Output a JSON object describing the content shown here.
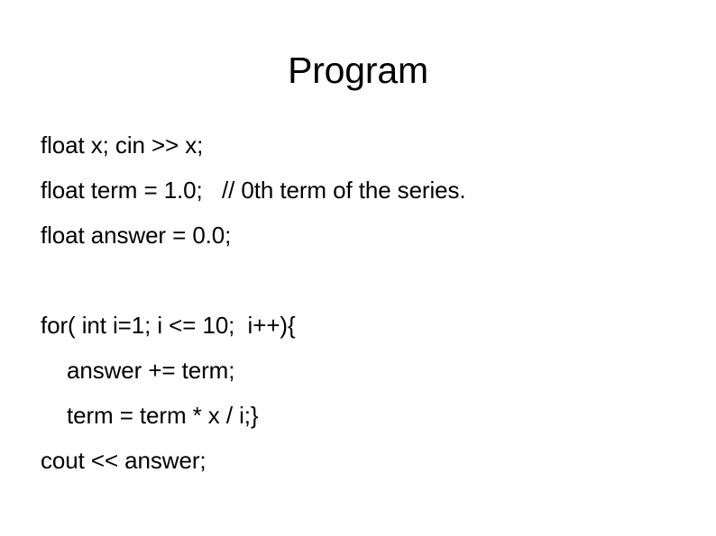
{
  "slide": {
    "title": "Program",
    "background_color": "#ffffff",
    "text_color": "#000000",
    "code_lines": [
      {
        "text": "float x; cin >> x;",
        "indent": false
      },
      {
        "text": "float term = 1.0;   // 0th term of the series.",
        "indent": false
      },
      {
        "text": "float answer = 0.0;",
        "indent": false
      },
      {
        "text": "",
        "indent": false
      },
      {
        "text": "for( int i=1; i <= 10;  i++){",
        "indent": false
      },
      {
        "text": "answer += term;",
        "indent": true
      },
      {
        "text": "term = term * x / i;}",
        "indent": true
      },
      {
        "text": "cout << answer;",
        "indent": false
      }
    ]
  }
}
